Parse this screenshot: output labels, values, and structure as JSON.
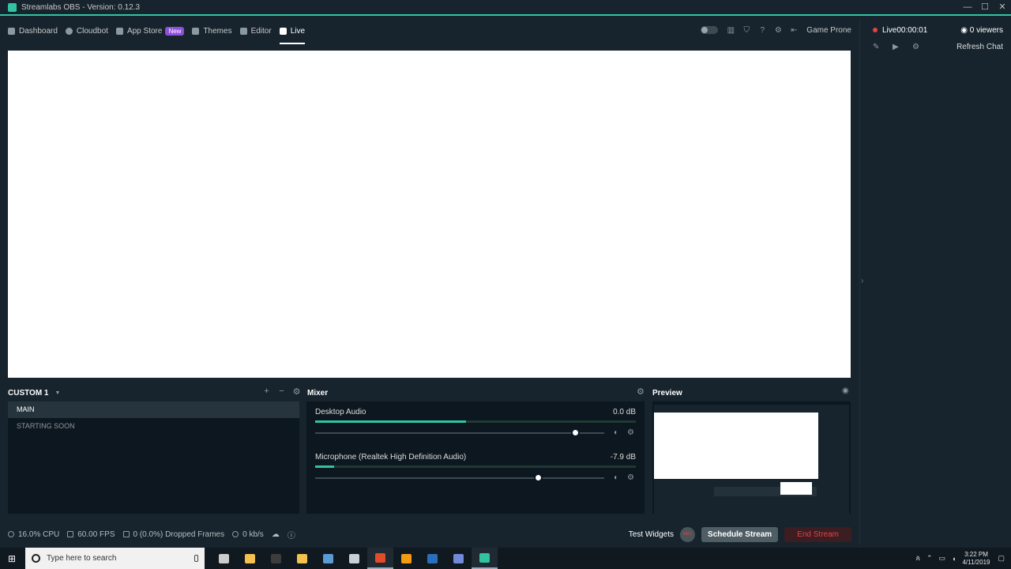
{
  "window": {
    "title": "Streamlabs OBS - Version: 0.12.3",
    "controls": [
      "—",
      "☐",
      "✕"
    ]
  },
  "nav": {
    "items": [
      {
        "label": "Dashboard",
        "icon": "dashboard-icon"
      },
      {
        "label": "Cloudbot",
        "icon": "cloudbot-icon"
      },
      {
        "label": "App Store",
        "icon": "store-icon",
        "badge": "New"
      },
      {
        "label": "Themes",
        "icon": "themes-icon"
      },
      {
        "label": "Editor",
        "icon": "editor-icon"
      },
      {
        "label": "Live",
        "icon": "live-icon",
        "active": true
      }
    ],
    "profile": "Game Prone"
  },
  "chat": {
    "live_label": "Live",
    "live_time": "00:00:01",
    "viewers": "0 viewers",
    "refresh": "Refresh Chat"
  },
  "scenes": {
    "title": "CUSTOM 1",
    "items": [
      "MAIN",
      "STARTING SOON"
    ]
  },
  "mixer": {
    "title": "Mixer",
    "channels": [
      {
        "name": "Desktop Audio",
        "db": "0.0 dB",
        "level": 0.47,
        "volume": 0.9
      },
      {
        "name": "Microphone (Realtek High Definition Audio)",
        "db": "-7.9 dB",
        "level": 0.06,
        "volume": 0.77
      }
    ]
  },
  "preview": {
    "title": "Preview"
  },
  "status": {
    "cpu": "16.0% CPU",
    "fps": "60.00 FPS",
    "dropped": "0 (0.0%) Dropped Frames",
    "bitrate": "0 kb/s",
    "rec_label": "REC",
    "test_widgets": "Test Widgets",
    "schedule": "Schedule Stream",
    "end": "End Stream"
  },
  "taskbar": {
    "search_placeholder": "Type here to search",
    "apps": [
      {
        "icon": "task-view-icon",
        "color": "#cccccc"
      },
      {
        "icon": "file-explorer-icon",
        "color": "#f2c14e"
      },
      {
        "icon": "terminal-icon",
        "color": "#3c3c3c"
      },
      {
        "icon": "store-app-icon",
        "color": "#f2c14e"
      },
      {
        "icon": "app-icon",
        "color": "#5b9bd5"
      },
      {
        "icon": "steam-like-icon",
        "color": "#c8d0d6"
      },
      {
        "icon": "chrome-icon",
        "color": "#e34c26"
      },
      {
        "icon": "vlc-icon",
        "color": "#f39c12"
      },
      {
        "icon": "steam-icon",
        "color": "#2a6fbd"
      },
      {
        "icon": "discord-icon",
        "color": "#7289da"
      },
      {
        "icon": "streamlabs-icon",
        "color": "#31c3a2"
      }
    ],
    "time": "3:22 PM",
    "date": "4/11/2019"
  }
}
